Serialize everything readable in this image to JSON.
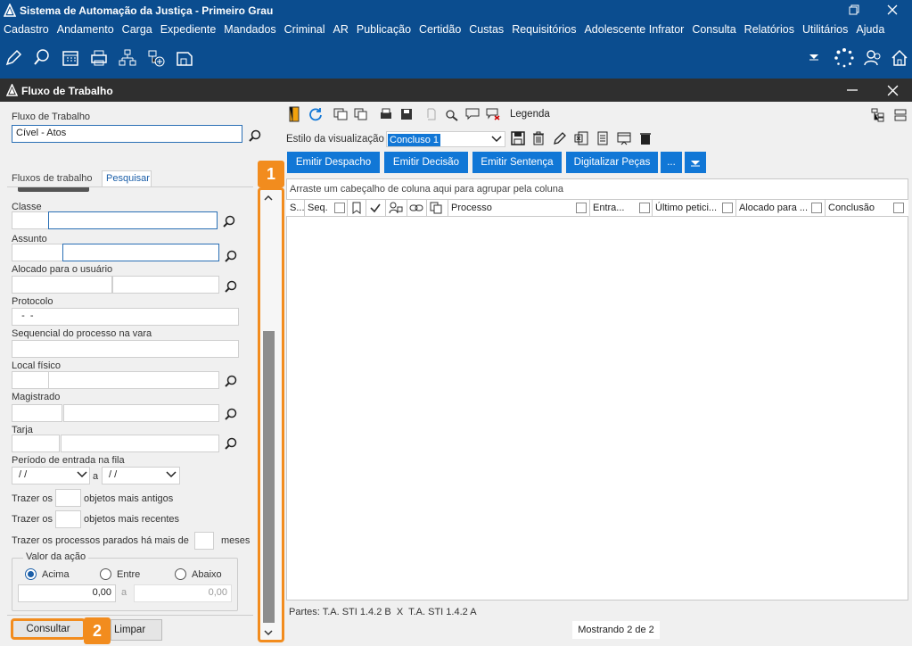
{
  "window": {
    "title": "Sistema de Automação da Justiça - Primeiro Grau"
  },
  "menu": [
    "Cadastro",
    "Andamento",
    "Carga",
    "Expediente",
    "Mandados",
    "Criminal",
    "AR",
    "Publicação",
    "Certidão",
    "Custas",
    "Requisitórios",
    "Adolescente Infrator",
    "Consulta",
    "Relatórios",
    "Utilitários",
    "Ajuda"
  ],
  "subwindow": {
    "title": "Fluxo de Trabalho"
  },
  "left": {
    "fluxo_label": "Fluxo de Trabalho",
    "fluxo_value": "Cível - Atos",
    "tabs": [
      "Fluxos de trabalho",
      "Pesquisar"
    ],
    "classe_label": "Classe",
    "assunto_label": "Assunto",
    "alocado_label": "Alocado para o usuário",
    "protocolo_label": "Protocolo",
    "protocolo_value": "  -  -",
    "sequencial_label": "Sequencial do processo na vara",
    "local_label": "Local físico",
    "magistrado_label": "Magistrado",
    "tarja_label": "Tarja",
    "periodo_label": "Período de entrada na fila",
    "periodo_from": " / /",
    "periodo_a": "a",
    "periodo_to": " / /",
    "antigos_pre": "Trazer os",
    "antigos_post": "objetos mais antigos",
    "recentes_pre": "Trazer os",
    "recentes_post": "objetos mais recentes",
    "parados_pre": "Trazer os processos parados há mais de",
    "parados_post": "meses",
    "valor_label": "Valor da ação",
    "radio_acima": "Acima",
    "radio_entre": "Entre",
    "radio_abaixo": "Abaixo",
    "valor_from": "0,00",
    "valor_a": "a",
    "valor_to": "0,00",
    "consultar": "Consultar",
    "limpar": "Limpar"
  },
  "badges": {
    "one": "1",
    "two": "2"
  },
  "right": {
    "legenda": "Legenda",
    "estilo_label": "Estilo da visualização",
    "estilo_value": "Concluso 1",
    "buttons": [
      "Emitir Despacho",
      "Emitir Decisão",
      "Emitir Sentença",
      "Digitalizar Peças",
      "..."
    ],
    "group_hint": "Arraste um cabeçalho de coluna aqui para agrupar pela coluna",
    "columns": [
      "S...",
      "Seq.",
      "Processo",
      "Entra...",
      "Último petici...",
      "Alocado para ...",
      "Conclusão"
    ],
    "partes": "Partes: T.A. STI 1.4.2 B  X  T.A. STI 1.4.2 A",
    "mostrando": "Mostrando 2 de 2"
  },
  "colors": {
    "titlebar": "#0b4d8f",
    "accent": "#1177d6",
    "badge": "#f28c1e"
  }
}
